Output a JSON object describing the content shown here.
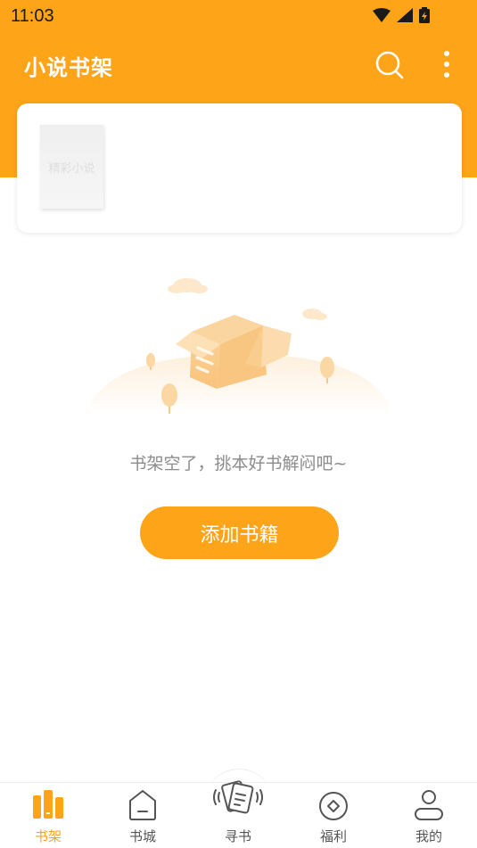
{
  "status_bar": {
    "time": "11:03"
  },
  "app_bar": {
    "title": "小说书架",
    "search_icon": "search-icon",
    "more_icon": "more-vertical-icon"
  },
  "recommend_card": {
    "cover_text": "精彩小说"
  },
  "empty_state": {
    "message": "书架空了，挑本好书解闷吧~",
    "button_label": "添加书籍"
  },
  "bottom_nav": {
    "items": [
      {
        "label": "书架",
        "icon": "bookshelf-icon",
        "active": true
      },
      {
        "label": "书城",
        "icon": "bookstore-icon",
        "active": false
      },
      {
        "label": "寻书",
        "icon": "shake-cards-icon",
        "active": false
      },
      {
        "label": "福利",
        "icon": "coin-icon",
        "active": false
      },
      {
        "label": "我的",
        "icon": "profile-icon",
        "active": false
      }
    ]
  },
  "colors": {
    "accent": "#FEA419",
    "muted_text": "#8c8c8c"
  }
}
